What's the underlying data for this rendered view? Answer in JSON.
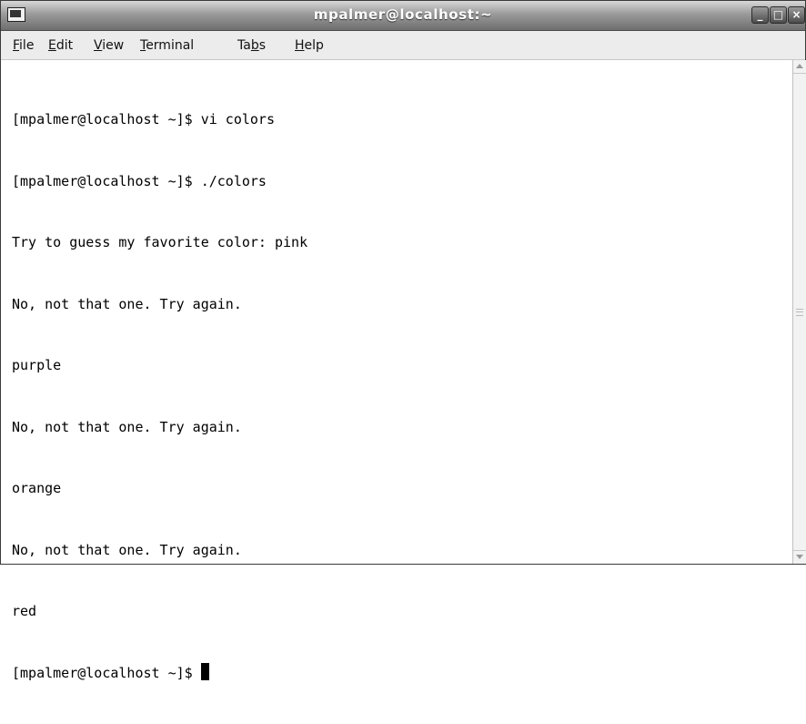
{
  "window": {
    "title": "mpalmer@localhost:~",
    "buttons": {
      "minimize_icon": "minimize-icon",
      "maximize_icon": "maximize-icon",
      "close_icon": "close-icon"
    }
  },
  "menubar": {
    "items": [
      {
        "acc": "F",
        "rest": "ile"
      },
      {
        "acc": "E",
        "rest": "dit"
      },
      {
        "acc": "V",
        "rest": "iew"
      },
      {
        "acc": "T",
        "rest": "erminal"
      },
      {
        "pre": "Ta",
        "acc": "b",
        "rest": "s"
      },
      {
        "acc": "H",
        "rest": "elp"
      }
    ]
  },
  "terminal": {
    "lines": [
      "[mpalmer@localhost ~]$ vi colors",
      "[mpalmer@localhost ~]$ ./colors",
      "Try to guess my favorite color: pink",
      "No, not that one. Try again.",
      "purple",
      "No, not that one. Try again.",
      "orange",
      "No, not that one. Try again.",
      "red"
    ],
    "prompt": "[mpalmer@localhost ~]$ "
  },
  "colors": {
    "titlebar_top": "#d8d8d8",
    "titlebar_bottom": "#6e6e6e",
    "menubar_bg": "#ececec",
    "terminal_bg": "#ffffff",
    "terminal_fg": "#000000"
  }
}
